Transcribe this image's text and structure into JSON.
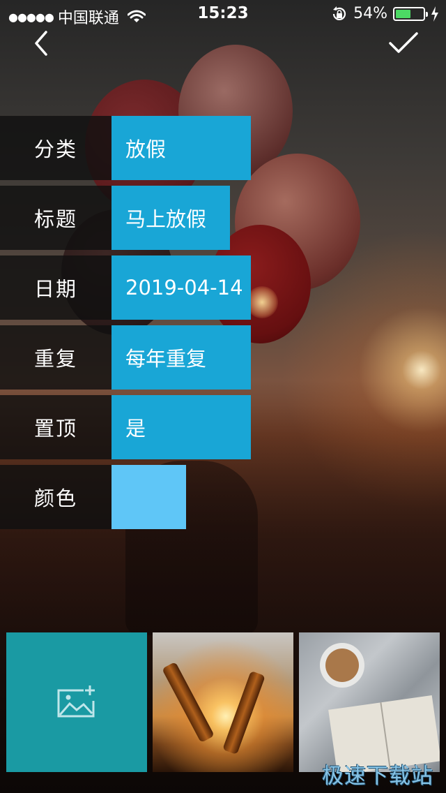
{
  "status_bar": {
    "signal_dots": "●●●●●",
    "carrier": "中国联通",
    "time": "15:23",
    "battery_percent": "54%",
    "battery_level": 0.54
  },
  "nav": {
    "back_icon": "chevron-left-icon",
    "confirm_icon": "checkmark-icon"
  },
  "form": {
    "rows": [
      {
        "label": "分类",
        "value": "放假"
      },
      {
        "label": "标题",
        "value": "马上放假"
      },
      {
        "label": "日期",
        "value": "2019-04-14"
      },
      {
        "label": "重复",
        "value": "每年重复"
      },
      {
        "label": "置顶",
        "value": "是"
      },
      {
        "label": "颜色",
        "color": "#5fc6f7"
      }
    ]
  },
  "gallery": {
    "add_icon": "add-image-icon",
    "tiles": [
      "beer-sunset-photo",
      "book-coffee-photo"
    ]
  },
  "watermark": "极速下载站",
  "colors": {
    "accent": "#19a6d6",
    "add_tile": "#1a9aa3",
    "battery": "#4cd964"
  }
}
